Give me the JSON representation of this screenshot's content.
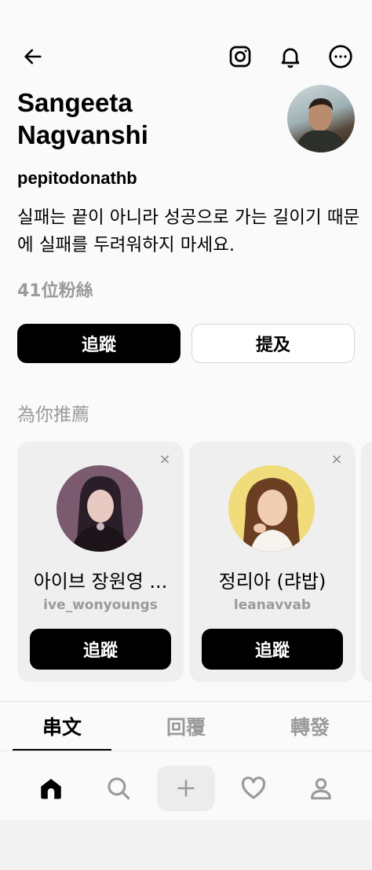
{
  "header": {
    "back_icon": "arrow-left-icon",
    "instagram_icon": "instagram-icon",
    "notifications_icon": "bell-icon",
    "more_icon": "more-horizontal-icon"
  },
  "profile": {
    "display_name": "Sangeeta Nagvanshi",
    "username": "pepitodonathb",
    "bio": "실패는 끝이 아니라 성공으로 가는 길이기 때문에 실패를 두려워하지 마세요.",
    "followers": "41位粉絲"
  },
  "actions": {
    "follow_label": "追蹤",
    "mention_label": "提及"
  },
  "suggestions": {
    "title": "為你推薦",
    "cards": [
      {
        "name": "아이브 장원영 ...",
        "username": "ive_wonyoungs",
        "button": "追蹤",
        "close": "×"
      },
      {
        "name": "정리아 (랴밥)",
        "username": "leanavvab",
        "button": "追蹤",
        "close": "×"
      }
    ]
  },
  "tabs": [
    {
      "label": "串文",
      "active": true
    },
    {
      "label": "回覆",
      "active": false
    },
    {
      "label": "轉發",
      "active": false
    }
  ],
  "bottom_nav": {
    "items": [
      "home-icon",
      "search-icon",
      "plus-icon",
      "heart-icon",
      "profile-icon"
    ]
  }
}
